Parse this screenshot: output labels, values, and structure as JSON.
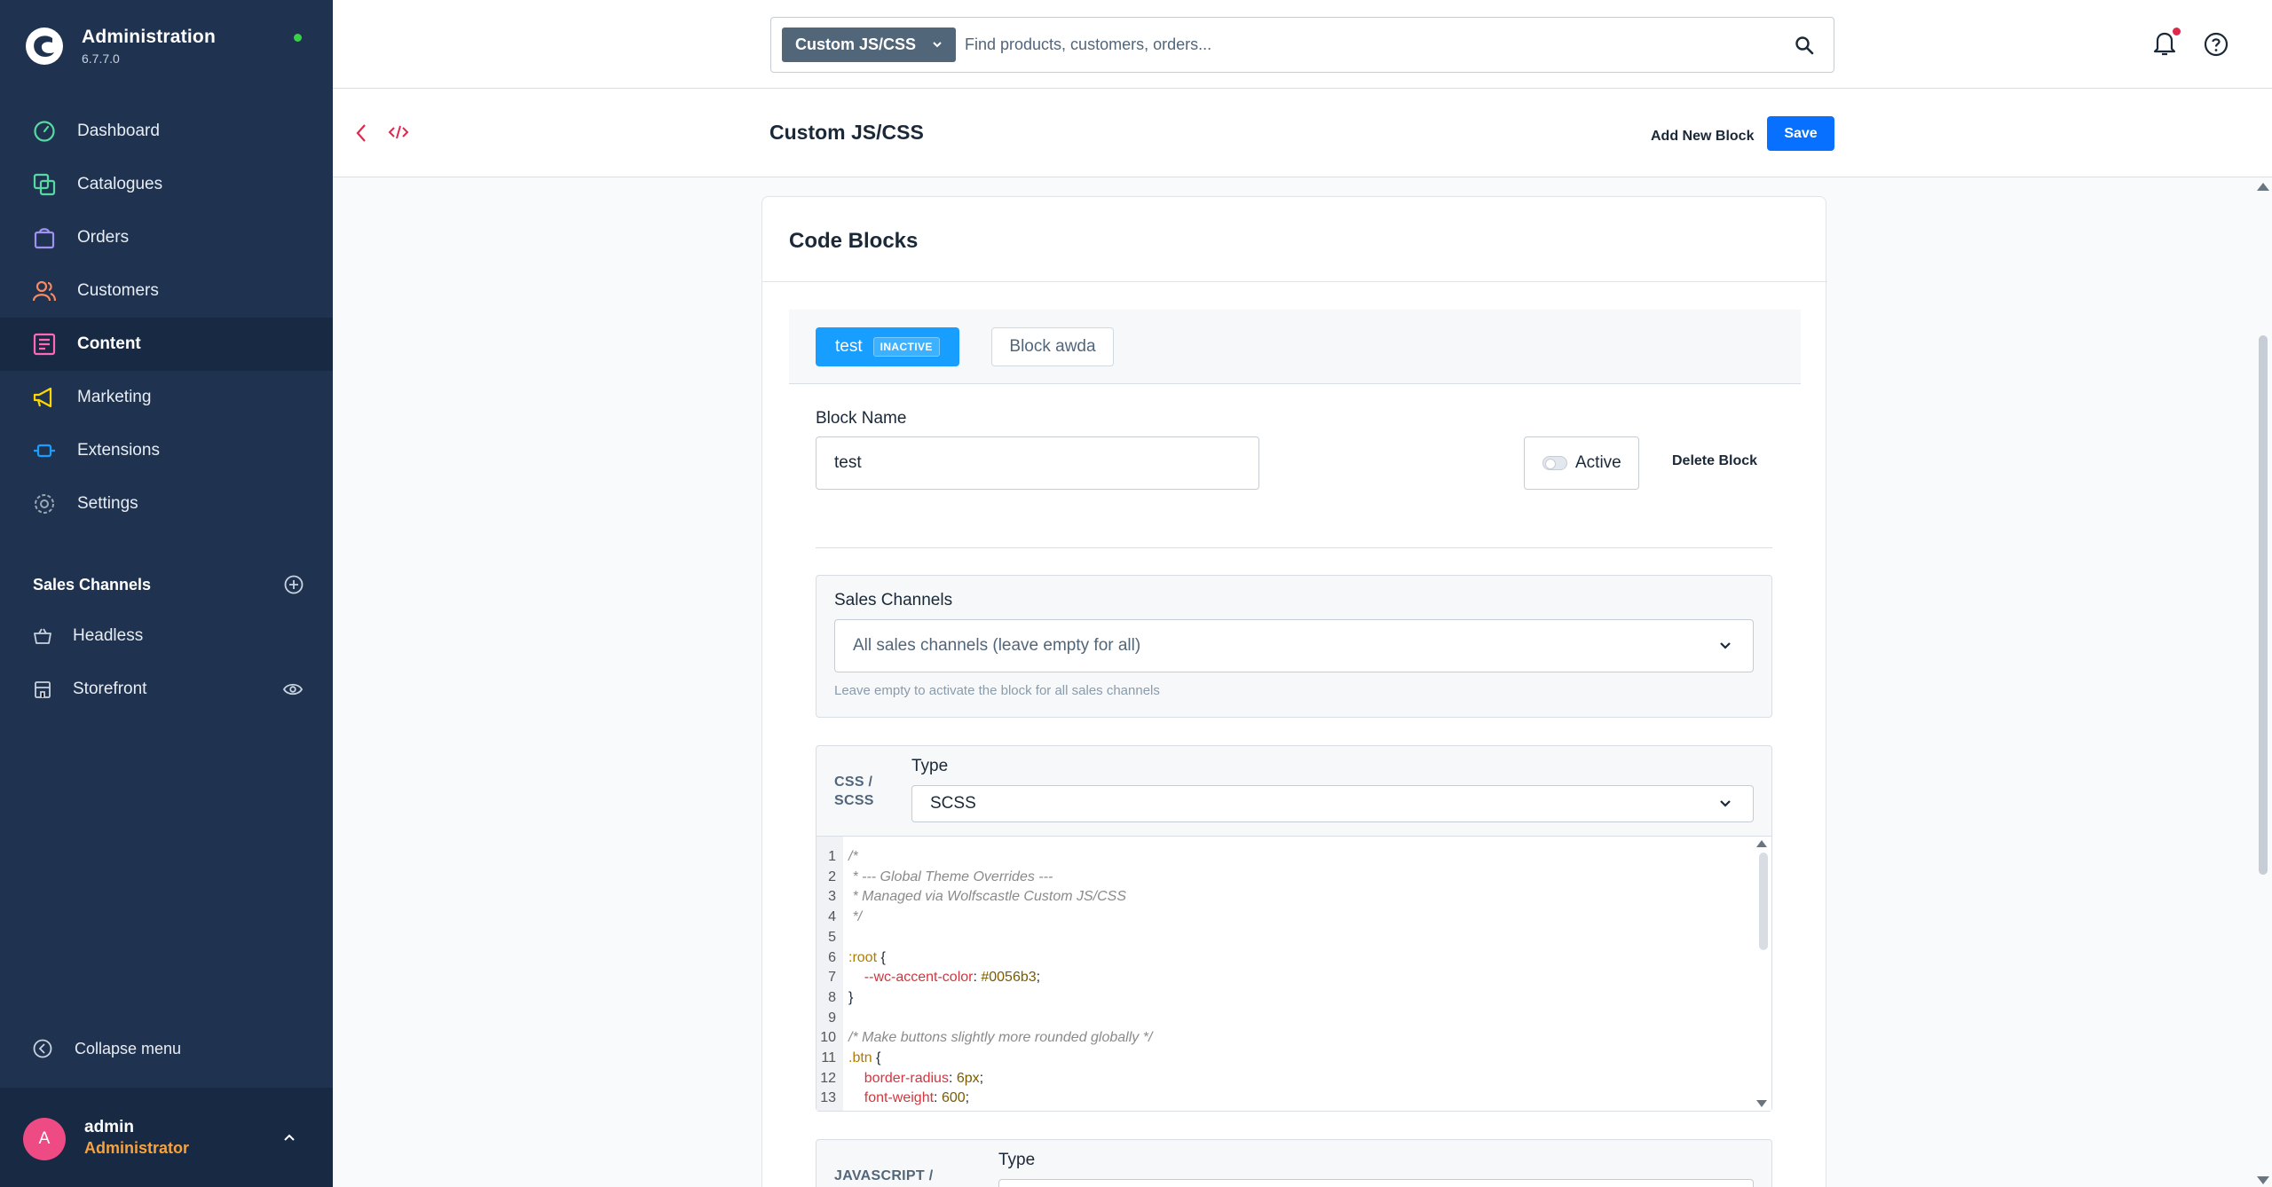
{
  "app": {
    "title": "Administration",
    "version": "6.7.7.0"
  },
  "sidebar": {
    "items": [
      {
        "label": "Dashboard",
        "icon": "dashboard-icon",
        "color": "#57d9a3"
      },
      {
        "label": "Catalogues",
        "icon": "catalogue-icon",
        "color": "#57d9a3"
      },
      {
        "label": "Orders",
        "icon": "orders-icon",
        "color": "#a092f0"
      },
      {
        "label": "Customers",
        "icon": "customers-icon",
        "color": "#f88962"
      },
      {
        "label": "Content",
        "icon": "content-icon",
        "color": "#ff68b4"
      },
      {
        "label": "Marketing",
        "icon": "marketing-icon",
        "color": "#ffd700"
      },
      {
        "label": "Extensions",
        "icon": "extensions-icon",
        "color": "#189eff"
      },
      {
        "label": "Settings",
        "icon": "settings-icon",
        "color": "#9aa8b5"
      }
    ],
    "sales_channels_title": "Sales Channels",
    "sales_channels": [
      {
        "label": "Headless",
        "icon": "basket-icon"
      },
      {
        "label": "Storefront",
        "icon": "storefront-icon"
      }
    ],
    "collapse_label": "Collapse menu",
    "user": {
      "initial": "A",
      "name": "admin",
      "role": "Administrator"
    }
  },
  "topbar": {
    "search_type": "Custom JS/CSS",
    "search_placeholder": "Find products, customers, orders..."
  },
  "smartbar": {
    "title": "Custom JS/CSS",
    "add_new_block": "Add New Block",
    "save": "Save"
  },
  "card": {
    "title": "Code Blocks",
    "tabs": [
      {
        "label": "test",
        "badge": "INACTIVE"
      },
      {
        "label": "Block awda"
      }
    ],
    "block_name_label": "Block Name",
    "block_name_value": "test",
    "active_label": "Active",
    "delete_block": "Delete Block",
    "sales_channels_label": "Sales Channels",
    "sales_channels_placeholder": "All sales channels (leave empty for all)",
    "sales_channels_help": "Leave empty to activate the block for all sales channels",
    "css_section_label_1": "CSS /",
    "css_section_label_2": "SCSS",
    "type_label": "Type",
    "css_type_value": "SCSS",
    "js_section_label": "JAVASCRIPT /",
    "js_type_label": "Type"
  },
  "code_lines": [
    {
      "n": "1",
      "text": "/*"
    },
    {
      "n": "2",
      "text": " * --- Global Theme Overrides ---"
    },
    {
      "n": "3",
      "text": " * Managed via Wolfscastle Custom JS/CSS"
    },
    {
      "n": "4",
      "text": " */"
    },
    {
      "n": "5",
      "text": ""
    },
    {
      "n": "6",
      "sel": ":root",
      "text": " {"
    },
    {
      "n": "7",
      "prop": "    --wc-accent-color",
      "val": "#0056b3"
    },
    {
      "n": "8",
      "text": "}"
    },
    {
      "n": "9",
      "text": ""
    },
    {
      "n": "10",
      "text": "/* Make buttons slightly more rounded globally */"
    },
    {
      "n": "11",
      "sel": ".btn",
      "text": " {"
    },
    {
      "n": "12",
      "prop": "    border-radius",
      "val": "6px"
    },
    {
      "n": "13",
      "prop": "    font-weight",
      "val": "600"
    }
  ]
}
